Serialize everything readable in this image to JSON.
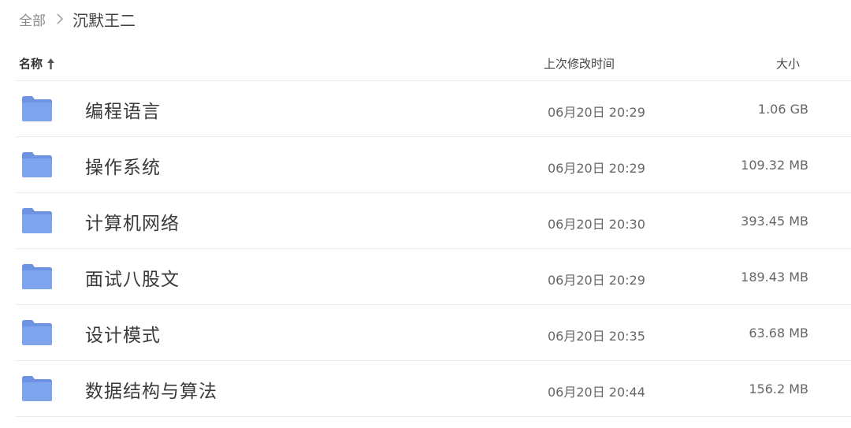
{
  "breadcrumb": {
    "root": "全部",
    "current": "沉默王二"
  },
  "header": {
    "name": "名称",
    "modified": "上次修改时间",
    "size": "大小",
    "sort_icon": "arrow-up-icon"
  },
  "colors": {
    "folder": "#7ea4ee",
    "folder_tab": "#6d93e2",
    "divider": "#ececec"
  },
  "files": [
    {
      "name": "编程语言",
      "modified": "06月20日 20:29",
      "size": "1.06 GB",
      "icon": "folder-icon"
    },
    {
      "name": "操作系统",
      "modified": "06月20日 20:29",
      "size": "109.32 MB",
      "icon": "folder-icon"
    },
    {
      "name": "计算机网络",
      "modified": "06月20日 20:30",
      "size": "393.45 MB",
      "icon": "folder-icon"
    },
    {
      "name": "面试八股文",
      "modified": "06月20日 20:29",
      "size": "189.43 MB",
      "icon": "folder-icon"
    },
    {
      "name": "设计模式",
      "modified": "06月20日 20:35",
      "size": "63.68 MB",
      "icon": "folder-icon"
    },
    {
      "name": "数据结构与算法",
      "modified": "06月20日 20:44",
      "size": "156.2 MB",
      "icon": "folder-icon"
    }
  ]
}
